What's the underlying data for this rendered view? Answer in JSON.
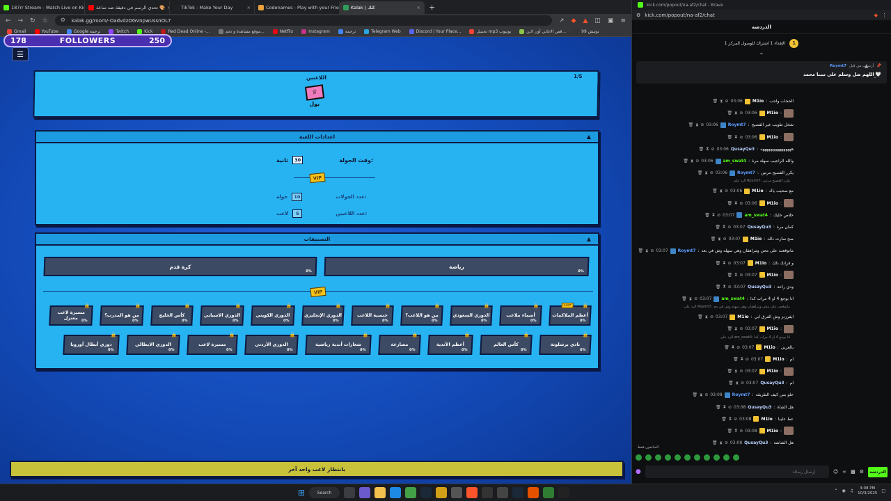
{
  "browser": {
    "tabs": [
      {
        "label": "187rr Stream - Watch Live on Kick",
        "color": "#53fc18"
      },
      {
        "label": "تحدي الرسم في دقيقة ضد ساعة 🎨",
        "color": "#ff0000"
      },
      {
        "label": "TikTok - Make Your Day",
        "color": "#222222"
      },
      {
        "label": "Codenames - Play with your Friends",
        "color": "#e9a23b"
      },
      {
        "label": "Kalak | كلك",
        "color": "#2f9b5a"
      }
    ],
    "url": "kalak.gg/room/-OadvdzOGVnpwUssnOL7",
    "bookmarks": [
      "Gmail",
      "YouTube",
      "Google ترجمة",
      "Twitch",
      "Kick",
      "Red Dead Online -...",
      "موقع مشاهدة و تحم...",
      "Netflix",
      "Instagram",
      "ترجمة",
      "Telegram Web",
      "Discord | Your Place...",
      "تحميل mp3 يوتيوب",
      "قص الاغاني أون لاين...",
      "توتيش 99"
    ]
  },
  "overlay": {
    "count_left": "178",
    "label": "FOLLOWERS",
    "count_right": "250"
  },
  "game": {
    "players_title": "اللاعبين",
    "players_count": "1/5",
    "host_name": "بول",
    "settings_title": "اعدادات اللعبة",
    "round_time_label": "وقت الجولة:",
    "round_time_value": "30",
    "round_time_unit": "ثانية",
    "vip_label": "VIP",
    "rounds_label": "عدد الجولات:",
    "rounds_value": "10",
    "rounds_unit": "جولة",
    "players_label": "عدد اللاعبين:",
    "players_value": "5",
    "players_unit": "لاعب",
    "categories_title": "التصنيفات",
    "big_categories": [
      {
        "label": "رياضة",
        "pct": "0%"
      },
      {
        "label": "كرة قدم",
        "pct": "0%"
      }
    ],
    "row1": [
      {
        "label": "أعظم الملاكمات",
        "pct": "0%",
        "tag": "جديد"
      },
      {
        "label": "أسماء ملاعب",
        "pct": "0%"
      },
      {
        "label": "الدوري السعودي",
        "pct": "0%"
      },
      {
        "label": "من هو اللاعب؟",
        "pct": "0%"
      },
      {
        "label": "جنسية اللاعب",
        "pct": "0%"
      },
      {
        "label": "الدوري الإنجليزي",
        "pct": "0%"
      },
      {
        "label": "الدوري الكويتي",
        "pct": "0%"
      },
      {
        "label": "الدوري الاسباني",
        "pct": "0%"
      },
      {
        "label": "كأس الخليج",
        "pct": "0%"
      },
      {
        "label": "من هو المدرب؟",
        "pct": "0%"
      },
      {
        "label": "مسيرة لاعب معتزل",
        "pct": "0%"
      }
    ],
    "row2": [
      {
        "label": "نادي برشلونة",
        "pct": "0%"
      },
      {
        "label": "كأس العالم",
        "pct": "0%"
      },
      {
        "label": "أعظم الأندية",
        "pct": "0%"
      },
      {
        "label": "مصارعة",
        "pct": "0%"
      },
      {
        "label": "شعارات أندية رياضية",
        "pct": "0%"
      },
      {
        "label": "الدوري الأردني",
        "pct": "0%"
      },
      {
        "label": "مسيرة لاعب",
        "pct": "0%"
      },
      {
        "label": "الدوري الايطالي",
        "pct": "0%"
      },
      {
        "label": "دوري أبطال أوروبا",
        "pct": "0%"
      }
    ],
    "bottom_text": "بانتظار لاعب واحد آخر"
  },
  "chat": {
    "window_title": "kick.com/popout/na-af2/chat - Brave",
    "url": "kick.com/popout/na-af2/chat",
    "header": "الدردشة",
    "leader_rank": "1",
    "leader_text": "الإهداء 1 اشتراك للوصول المركز 1",
    "pinned_by": "أرسلت من قبل",
    "pinned_user": "Roymt7",
    "pinned_text": "اللهم صل وسلم على نبينا محمد 🤍",
    "messages": [
      {
        "time": "03:06",
        "user": "M1io",
        "color": "#ffffff",
        "text": "الحجاب واجب",
        "bdg": "#f1c232"
      },
      {
        "time": "03:06",
        "user": "M1io",
        "color": "#ffffff",
        "text": "",
        "emote": true,
        "bdg": "#f1c232"
      },
      {
        "time": "03:06",
        "user": "Roymt7",
        "color": "#5b9bff",
        "text": "شخل طويب غير الفصيح",
        "bdg": "#3d85c6"
      },
      {
        "time": "03:06",
        "user": "M1io",
        "color": "#ffffff",
        "text": "",
        "emote": true,
        "bdg": "#f1c232"
      },
      {
        "time": "03:06",
        "user": "QusayQu3",
        "color": "#b9d0ff",
        "text": "ههههههههههههههههه",
        "bdg": ""
      },
      {
        "time": "03:06",
        "user": "am_swat4",
        "color": "#53fc18",
        "text": "والله الراجيب سهلة مرة",
        "bdg": "#3d85c6"
      },
      {
        "time": "03:06",
        "user": "Roymt7",
        "color": "#5b9bff",
        "text": "يكرر الفصيح مرتين",
        "bdg": "#3d85c6"
      },
      {
        "time": "03:06",
        "user": "M1io",
        "color": "#ffffff",
        "text": "مع صحيب ياك",
        "bdg": "#f1c232",
        "reply": "الرد على Roymt7: يكرر الفصيح مرتين"
      },
      {
        "time": "03:06",
        "user": "M1io",
        "color": "#ffffff",
        "text": "",
        "emote": true,
        "bdg": "#f1c232"
      },
      {
        "time": "03:07",
        "user": "am_swat4",
        "color": "#53fc18",
        "text": "خلاص خليك",
        "bdg": "#3d85c6"
      },
      {
        "time": "03:07",
        "user": "QusayQu3",
        "color": "#b9d0ff",
        "text": "كمان مرة",
        "bdg": ""
      },
      {
        "time": "03:07",
        "user": "M1io",
        "color": "#ffffff",
        "text": "صح سارت ذلك",
        "bdg": "#f1c232"
      },
      {
        "time": "03:07",
        "user": "Roymt7",
        "color": "#5b9bff",
        "text": "ماتوقعت على محن ومراهقان وهي سهله وش في بعد",
        "bdg": "#3d85c6"
      },
      {
        "time": "03:07",
        "user": "M1io",
        "color": "#ffffff",
        "text": "و قرانك ذلك",
        "bdg": "#f1c232"
      },
      {
        "time": "03:07",
        "user": "M1io",
        "color": "#ffffff",
        "text": "",
        "emote": true,
        "bdg": "#f1c232"
      },
      {
        "time": "03:07",
        "user": "QusayQu3",
        "color": "#b9d0ff",
        "text": "ودي راحة",
        "bdg": ""
      },
      {
        "time": "03:07",
        "user": "am_swat4",
        "color": "#53fc18",
        "text": "انا بوجع 4 او 4 مرات كذا",
        "bdg": "#3d85c6"
      },
      {
        "time": "03:07",
        "user": "M1io",
        "color": "#ffffff",
        "text": "ايفرزنز وش الفرق ابي",
        "bdg": "#f1c232",
        "reply": "الرد على Roymt7: ماتوقعت على محن ومراهقان وهي سهله وش في بعد"
      },
      {
        "time": "03:07",
        "user": "M1io",
        "color": "#ffffff",
        "text": "",
        "emote": true,
        "bdg": "#f1c232"
      },
      {
        "time": "03:07",
        "user": "M1io",
        "color": "#ffffff",
        "text": "بالعربي",
        "bdg": "#f1c232",
        "reply": "الرد على am_swat4: انا بوجع 4 او 4 مرات كذا"
      },
      {
        "time": "03:07",
        "user": "M1io",
        "color": "#ffffff",
        "text": "ام",
        "bdg": "#f1c232"
      },
      {
        "time": "03:07",
        "user": "M1io",
        "color": "#ffffff",
        "text": "",
        "emote": true,
        "bdg": "#f1c232"
      },
      {
        "time": "03:07",
        "user": "QusayQu3",
        "color": "#b9d0ff",
        "text": "ام",
        "bdg": ""
      },
      {
        "time": "03:08",
        "user": "Roymt7",
        "color": "#5b9bff",
        "text": "حلو بس كيف الطريقة",
        "bdg": "#3d85c6"
      },
      {
        "time": "03:08",
        "user": "QusayQu3",
        "color": "#b9d0ff",
        "text": "هل الشاة",
        "bdg": ""
      },
      {
        "time": "03:08",
        "user": "M1io",
        "color": "#ffffff",
        "text": "عط علينا",
        "bdg": "#f1c232"
      },
      {
        "time": "03:08",
        "user": "M1io",
        "color": "#ffffff",
        "text": "",
        "emote": true,
        "bdg": "#f1c232"
      },
      {
        "time": "03:08",
        "user": "QusayQu3",
        "color": "#b9d0ff",
        "text": "هل الشاشة",
        "bdg": ""
      }
    ],
    "followers_only": "المتابعون فقط",
    "input_placeholder": "إرسال رسالة",
    "send_label": "الدردشة"
  },
  "taskbar": {
    "search": "Search",
    "time": "3:08 PM",
    "date": "10/3/2025"
  }
}
